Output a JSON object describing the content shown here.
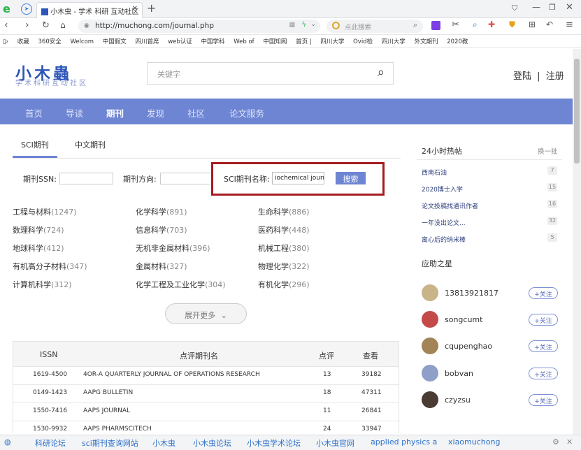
{
  "browser": {
    "tab_title": "小木虫 - 学术 科研 互动社区",
    "url": "http://muchong.com/journal.php",
    "search_placeholder": "点此搜索",
    "bookmarks": [
      "收藏",
      "360安全",
      "Welcom",
      "中国假文",
      "四川首席",
      "web认证",
      "中国学科",
      "Web of",
      "中国知网",
      "首页 |",
      "四川大学",
      "Ovid检",
      "四川大学",
      "外文期刊",
      "2020教"
    ]
  },
  "site": {
    "logo": "小木蟲",
    "logo_sub": "学术科研互动社区",
    "search_placeholder": "关键字",
    "login": "登陆",
    "separator": "|",
    "register": "注册",
    "nav": [
      "首页",
      "导读",
      "期刊",
      "发现",
      "社区",
      "论文服务"
    ],
    "nav_active_index": 2
  },
  "journal": {
    "tabs": [
      "SCI期刊",
      "中文期刊"
    ],
    "active_tab": "SCI期刊",
    "issn_label": "期刊SSN:",
    "issn_value": "",
    "direction_label": "期刊方向:",
    "direction_value": "",
    "name_label": "SCI期刊名称:",
    "name_value": "iochemical journa",
    "search_button": "搜索",
    "categories": [
      {
        "name": "工程与材料",
        "count": "(1247)"
      },
      {
        "name": "化学科学",
        "count": "(891)"
      },
      {
        "name": "生命科学",
        "count": "(886)"
      },
      {
        "name": "数理科学",
        "count": "(724)"
      },
      {
        "name": "信息科学",
        "count": "(703)"
      },
      {
        "name": "医药科学",
        "count": "(448)"
      },
      {
        "name": "地球科学",
        "count": "(412)"
      },
      {
        "name": "无机非金属材料",
        "count": "(396)"
      },
      {
        "name": "机械工程",
        "count": "(380)"
      },
      {
        "name": "有机高分子材料",
        "count": "(347)"
      },
      {
        "name": "金属材料",
        "count": "(327)"
      },
      {
        "name": "物理化学",
        "count": "(322)"
      },
      {
        "name": "计算机科学",
        "count": "(312)"
      },
      {
        "name": "化学工程及工业化学",
        "count": "(304)"
      },
      {
        "name": "有机化学",
        "count": "(296)"
      }
    ],
    "expand_button": "展开更多",
    "table_headers": [
      "ISSN",
      "点评期刊名",
      "点评",
      "查看"
    ],
    "rows": [
      {
        "issn": "1619-4500",
        "name": "4OR-A QUARTERLY JOURNAL OF OPERATIONS RESEARCH",
        "reviews": "13",
        "views": "39182"
      },
      {
        "issn": "0149-1423",
        "name": "AAPG BULLETIN",
        "reviews": "18",
        "views": "47311"
      },
      {
        "issn": "1550-7416",
        "name": "AAPS JOURNAL",
        "reviews": "11",
        "views": "26841"
      },
      {
        "issn": "1530-9932",
        "name": "AAPS PHARMSCITECH",
        "reviews": "24",
        "views": "33947"
      }
    ]
  },
  "sidebar": {
    "hot_title": "24小时热帖",
    "refresh": "换一批",
    "hot_posts": [
      {
        "title": "西南石油",
        "count": "7"
      },
      {
        "title": "2020博士入学",
        "count": "15"
      },
      {
        "title": "论文投稿找通讯作者",
        "count": "16"
      },
      {
        "title": "一年没出论文...",
        "count": "32"
      },
      {
        "title": "离心后的纳米棒",
        "count": "5"
      }
    ],
    "stars_title": "应助之星",
    "stars": [
      {
        "name": "13813921817",
        "follow": "+关注"
      },
      {
        "name": "songcumt",
        "follow": "+关注"
      },
      {
        "name": "cqupenghao",
        "follow": "+关注"
      },
      {
        "name": "bobvan",
        "follow": "+关注"
      },
      {
        "name": "czyzsu",
        "follow": "+关注"
      }
    ]
  },
  "statusbar": {
    "links": [
      "科研论坛",
      "sci期刊查询网站",
      "小木虫",
      "小木虫论坛",
      "小木虫学术论坛",
      "小木虫官网",
      "applied physics a",
      "xiaomuchong"
    ]
  },
  "colors": {
    "nav": "#6e85d3",
    "highlight_box": "#a51c20",
    "link": "#2b6fc9"
  }
}
